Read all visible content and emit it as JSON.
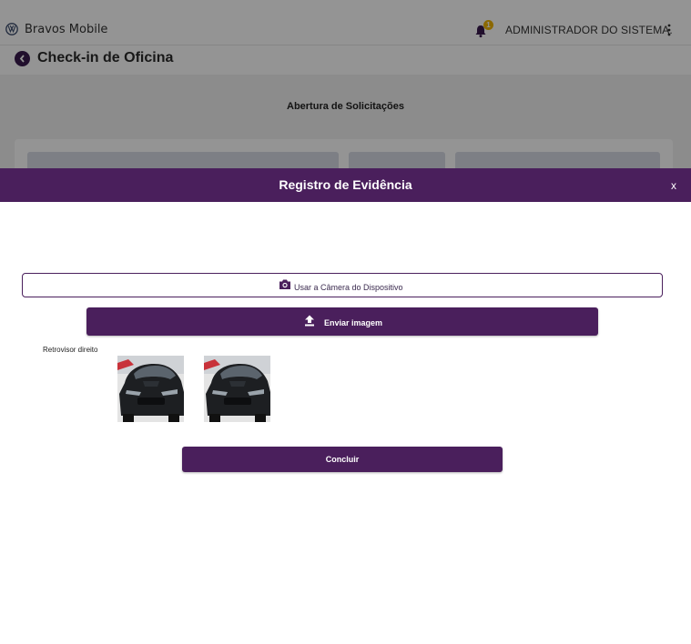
{
  "app": {
    "name": "Bravos Mobile",
    "notification_count": "1",
    "user_name": "ADMINISTRADOR DO SISTEMA.",
    "page_title": "Check-in de Oficina",
    "section_title": "Abertura de Solicitações"
  },
  "modal": {
    "title": "Registro de Evidência",
    "close_label": "x",
    "camera_button_label": "Usar a Câmera do Dispositivo",
    "upload_button_label": "Enviar imagem",
    "evidence_label": "Retrovisor direito",
    "conclude_button_label": "Concluir"
  },
  "colors": {
    "brand_purple": "#4a1f5c",
    "badge": "#f0b400"
  },
  "icons": {
    "camera": "camera-icon",
    "upload": "upload-icon",
    "bell": "bell-icon",
    "back": "back-arrow-icon",
    "kebab": "more-vertical-icon",
    "logo": "vw-logo-icon"
  }
}
